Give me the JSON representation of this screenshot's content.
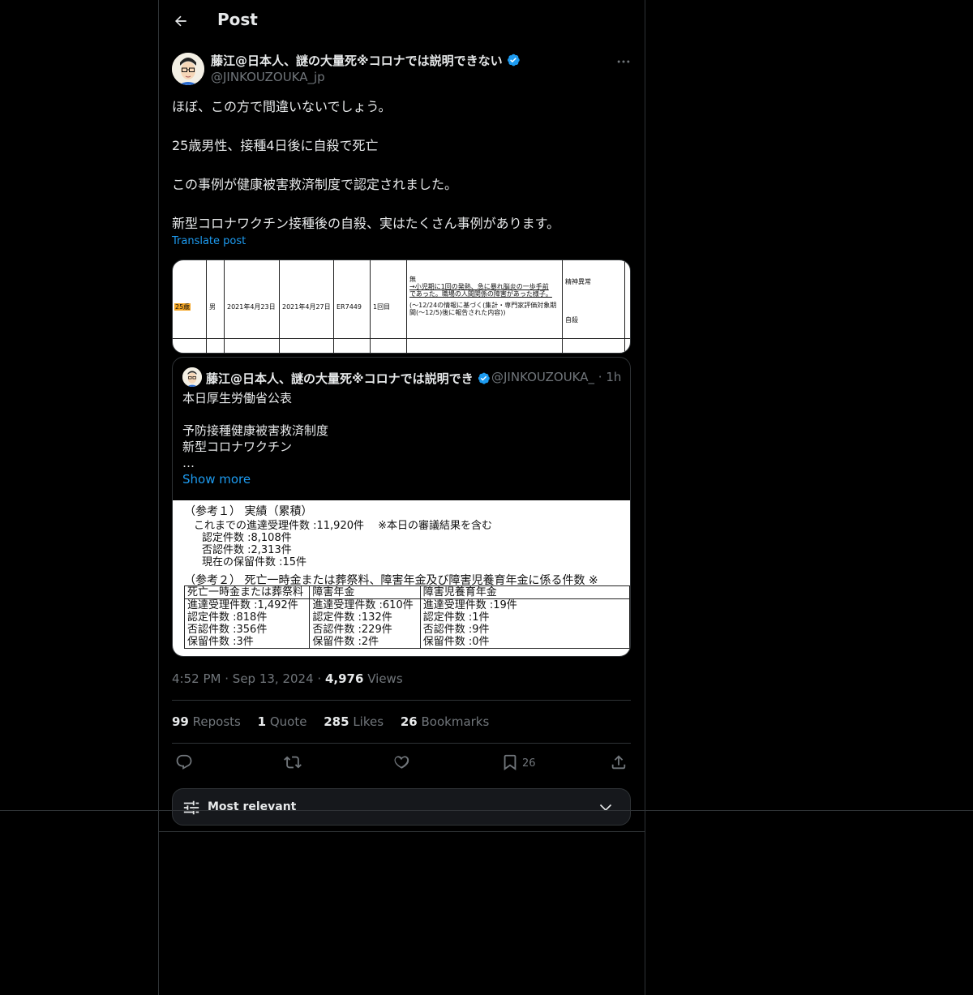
{
  "header": {
    "title": "Post"
  },
  "post": {
    "author_name": "藤江@日本人、謎の大量死※コロナでは説明できない",
    "author_handle": "@JINKOUZOUKA_jp",
    "lines": [
      "ほぼ、この方で間違いないでしょう。",
      "25歳男性、接種4日後に自殺で死亡",
      "この事例が健康被害救済制度で認定されました。",
      "新型コロナワクチン接種後の自殺、実はたくさん事例があります。"
    ],
    "translate_label": "Translate post"
  },
  "image1": {
    "cells": {
      "age": "25歳",
      "sex": "男",
      "date1": "2021年4月23日",
      "date2": "2021年4月27日",
      "lot": "ER7449",
      "dose": "1回目",
      "history_1": "無",
      "history_2": "→小児期に1回の発熱、急に暴れ脳炎の一歩手前",
      "history_3": "であった。職場の人間関係の障害があった様子。",
      "history_4": "(～12/24の情報に基づく(集計・専門家評価対象期",
      "history_5": "間(～12/5)後に報告された内容))",
      "symptom": "精神異常",
      "outcome": "自殺"
    }
  },
  "quote": {
    "author_name": "藤江@日本人、謎の大量死※コロナでは説明でき",
    "author_handle": "@JINKOUZOUKA_",
    "time": "· 1h",
    "lines": [
      "本日厚生労働省公表",
      "",
      "予防接種健康被害救済制度",
      "新型コロナワクチン",
      "…"
    ],
    "show_more": "Show more"
  },
  "image2": {
    "heading1": "（参考１） 実績（累積）",
    "l1": "これまでの進達受理件数 :11,920件　 ※本日の審議結果を含む",
    "l2": "認定件数 :8,108件",
    "l3": "否認件数 :2,313件",
    "l4": "現在の保留件数 :15件",
    "heading2": "（参考２） 死亡一時金または葬祭料、障害年金及び障害児養育年金に係る件数 ※",
    "table": {
      "headers": [
        "死亡一時金または葬祭料",
        "障害年金",
        "障害児養育年金"
      ],
      "rows": [
        [
          "進達受理件数 :1,492件",
          "進達受理件数 :610件",
          "進達受理件数 :19件"
        ],
        [
          "認定件数 :818件",
          "認定件数 :132件",
          "認定件数 :1件"
        ],
        [
          "否認件数 :356件",
          "否認件数 :229件",
          "否認件数 :9件"
        ],
        [
          "保留件数 :3件",
          "保留件数 :2件",
          "保留件数 :0件"
        ]
      ]
    }
  },
  "meta": {
    "time": "4:52 PM",
    "dot1": "·",
    "date": "Sep 13, 2024",
    "dot2": "·",
    "views_count": "4,976",
    "views_label": "Views"
  },
  "stats": {
    "reposts_count": "99",
    "reposts_label": "Reposts",
    "quotes_count": "1",
    "quotes_label": "Quote",
    "likes_count": "285",
    "likes_label": "Likes",
    "bookmarks_count": "26",
    "bookmarks_label": "Bookmarks"
  },
  "actions": {
    "bookmark_count": "26"
  },
  "sort": {
    "label": "Most relevant"
  },
  "colors": {
    "accent": "#1d9bf0",
    "border": "#2f3336",
    "muted": "#71767b",
    "text": "#e7e9ea"
  },
  "icons": [
    "back-arrow-icon",
    "verified-badge-icon",
    "more-icon",
    "reply-icon",
    "repost-icon",
    "like-icon",
    "bookmark-icon",
    "share-icon",
    "sliders-icon",
    "chevron-down-icon"
  ]
}
